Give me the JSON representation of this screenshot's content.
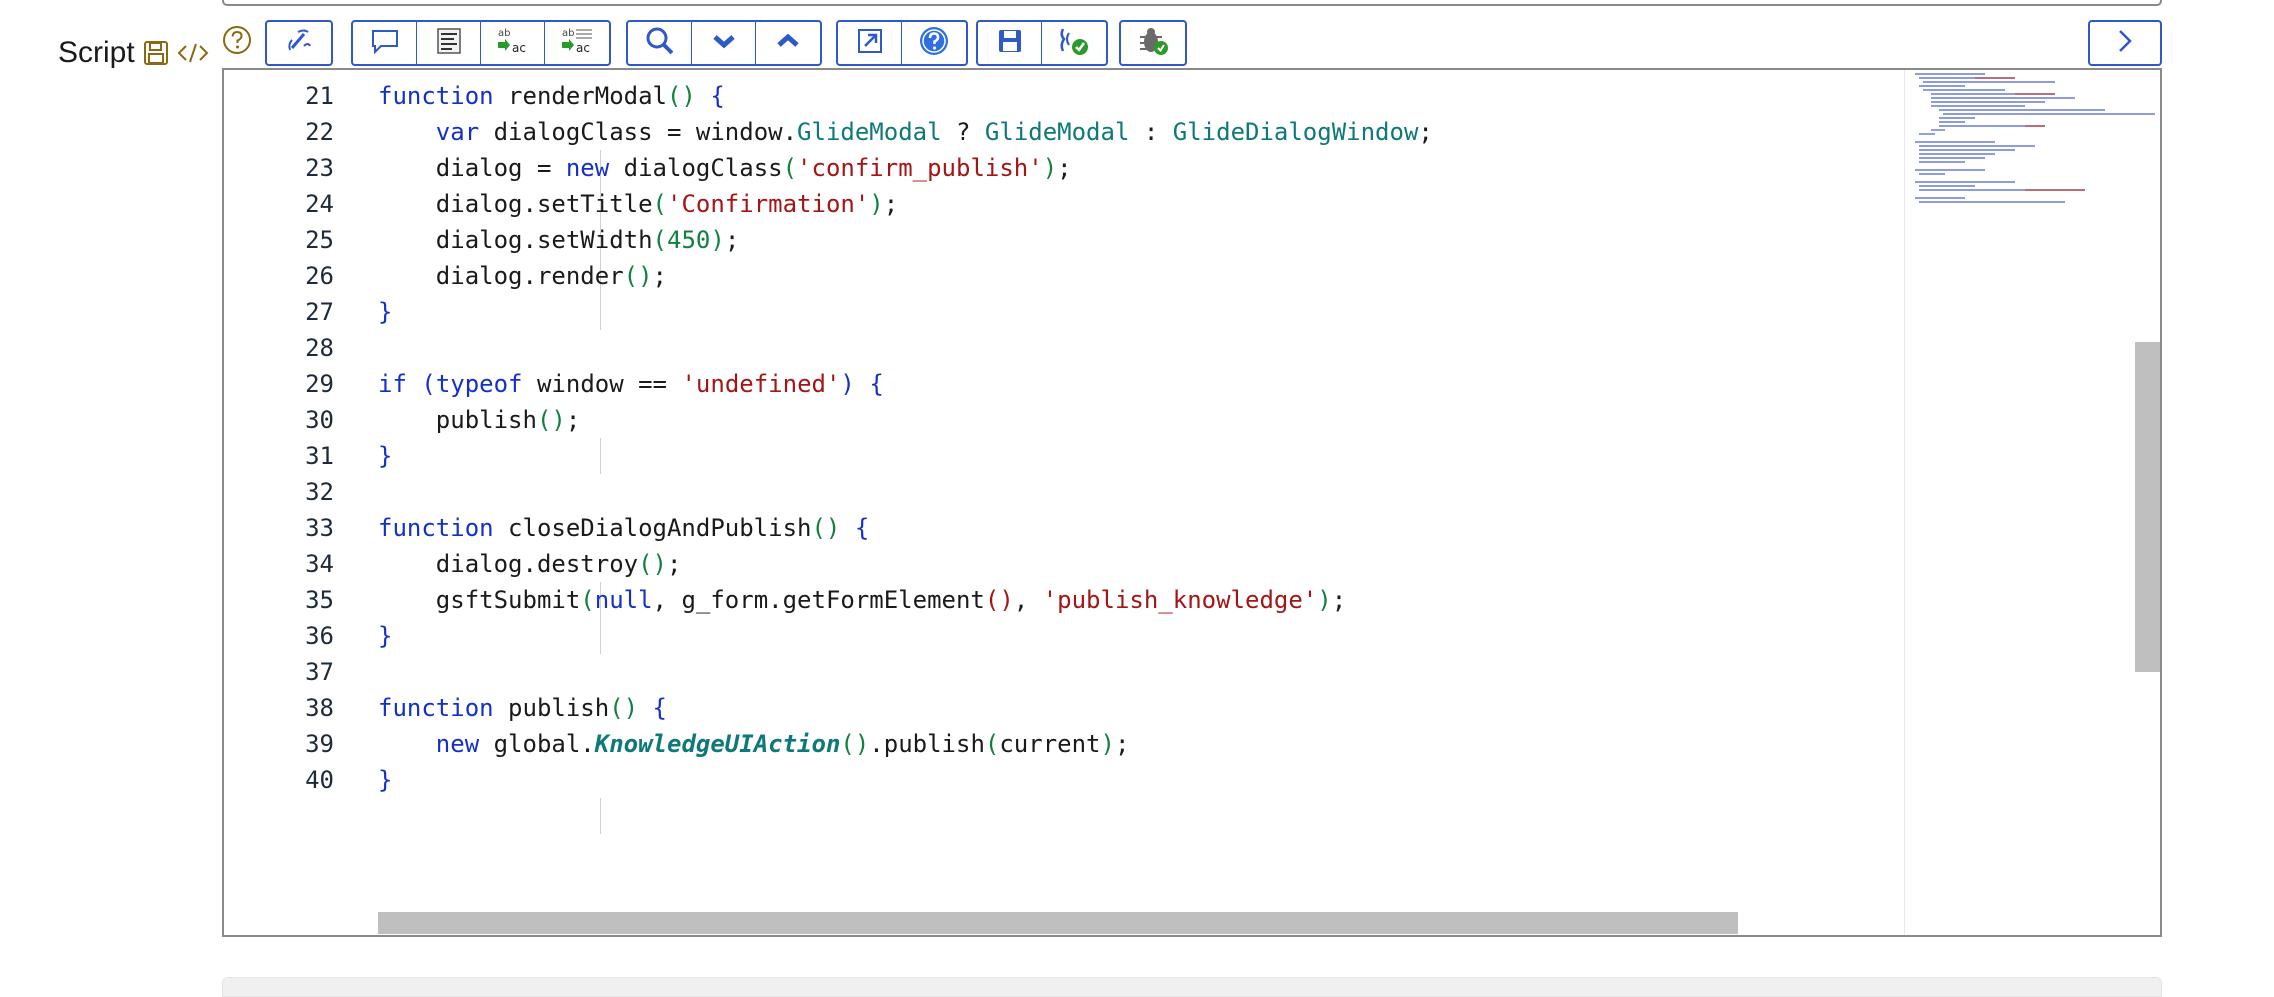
{
  "field": {
    "label": "Script",
    "save_icon": "floppy-icon",
    "code_icon": "code-tag-icon",
    "help_icon": "question-circle-icon"
  },
  "toolbar": {
    "groups": [
      [
        {
          "name": "format-code-button",
          "icon": "wand-icon"
        }
      ],
      [
        {
          "name": "toggle-comment-button",
          "icon": "comment-icon"
        },
        {
          "name": "format-text-button",
          "icon": "text-lines-icon"
        },
        {
          "name": "replace-button",
          "icon": "replace-icon"
        },
        {
          "name": "replace-all-button",
          "icon": "replace-all-icon"
        }
      ],
      [
        {
          "name": "search-button",
          "icon": "magnifier-icon"
        },
        {
          "name": "find-next-button",
          "icon": "chevron-down-icon"
        },
        {
          "name": "find-previous-button",
          "icon": "chevron-up-icon"
        }
      ],
      [
        {
          "name": "fullscreen-button",
          "icon": "expand-arrow-icon"
        },
        {
          "name": "help-button",
          "icon": "help-circle-icon"
        }
      ],
      [
        {
          "name": "save-button",
          "icon": "floppy-icon"
        },
        {
          "name": "syntax-check-button",
          "icon": "check-script-icon"
        }
      ],
      [
        {
          "name": "debug-button",
          "icon": "bug-icon"
        }
      ]
    ],
    "right_button_icon": "chevron-right-icon"
  },
  "colors": {
    "accent": "#2f58c8",
    "keyword": "#1430c8",
    "string": "#a41515",
    "number": "#108040",
    "class": "#0f7878"
  },
  "code_lines": [
    {
      "n": "21",
      "t": [
        [
          "kw",
          "function"
        ],
        [
          "p",
          " renderModal"
        ],
        [
          "paren",
          "()"
        ],
        [
          "p",
          " "
        ],
        [
          "kw",
          "{"
        ]
      ]
    },
    {
      "n": "22",
      "t": [
        [
          "p",
          "    "
        ],
        [
          "kw",
          "var"
        ],
        [
          "p",
          " dialogClass = window."
        ],
        [
          "cls",
          "GlideModal"
        ],
        [
          "p",
          " ? "
        ],
        [
          "cls",
          "GlideModal"
        ],
        [
          "p",
          " : "
        ],
        [
          "cls",
          "GlideDialogWindow"
        ],
        [
          "p",
          ";"
        ]
      ]
    },
    {
      "n": "23",
      "t": [
        [
          "p",
          "    dialog = "
        ],
        [
          "kw",
          "new"
        ],
        [
          "p",
          " dialogClass"
        ],
        [
          "paren",
          "("
        ],
        [
          "str",
          "'confirm_publish'"
        ],
        [
          "paren",
          ")"
        ],
        [
          "p",
          ";"
        ]
      ]
    },
    {
      "n": "24",
      "t": [
        [
          "p",
          "    dialog.setTitle"
        ],
        [
          "paren",
          "("
        ],
        [
          "str",
          "'Confirmation'"
        ],
        [
          "paren",
          ")"
        ],
        [
          "p",
          ";"
        ]
      ]
    },
    {
      "n": "25",
      "t": [
        [
          "p",
          "    dialog.setWidth"
        ],
        [
          "paren",
          "("
        ],
        [
          "num",
          "450"
        ],
        [
          "paren",
          ")"
        ],
        [
          "p",
          ";"
        ]
      ]
    },
    {
      "n": "26",
      "t": [
        [
          "p",
          "    dialog.render"
        ],
        [
          "paren",
          "()"
        ],
        [
          "p",
          ";"
        ]
      ]
    },
    {
      "n": "27",
      "t": [
        [
          "kw",
          "}"
        ]
      ]
    },
    {
      "n": "28",
      "t": []
    },
    {
      "n": "29",
      "t": [
        [
          "kw",
          "if"
        ],
        [
          "p",
          " "
        ],
        [
          "kw",
          "("
        ],
        [
          "kw",
          "typeof"
        ],
        [
          "p",
          " window == "
        ],
        [
          "str",
          "'undefined'"
        ],
        [
          "kw",
          ")"
        ],
        [
          "p",
          " "
        ],
        [
          "kw",
          "{"
        ]
      ]
    },
    {
      "n": "30",
      "t": [
        [
          "p",
          "    publish"
        ],
        [
          "paren",
          "()"
        ],
        [
          "p",
          ";"
        ]
      ]
    },
    {
      "n": "31",
      "t": [
        [
          "kw",
          "}"
        ]
      ]
    },
    {
      "n": "32",
      "t": []
    },
    {
      "n": "33",
      "t": [
        [
          "kw",
          "function"
        ],
        [
          "p",
          " closeDialogAndPublish"
        ],
        [
          "paren",
          "()"
        ],
        [
          "p",
          " "
        ],
        [
          "kw",
          "{"
        ]
      ]
    },
    {
      "n": "34",
      "t": [
        [
          "p",
          "    dialog.destroy"
        ],
        [
          "paren",
          "()"
        ],
        [
          "p",
          ";"
        ]
      ]
    },
    {
      "n": "35",
      "t": [
        [
          "p",
          "    gsftSubmit"
        ],
        [
          "paren",
          "("
        ],
        [
          "kw",
          "null"
        ],
        [
          "p",
          ", g_form.getFormElement"
        ],
        [
          "str",
          "()"
        ],
        [
          "p",
          ", "
        ],
        [
          "str",
          "'publish_knowledge'"
        ],
        [
          "paren",
          ")"
        ],
        [
          "p",
          ";"
        ]
      ]
    },
    {
      "n": "36",
      "t": [
        [
          "kw",
          "}"
        ]
      ]
    },
    {
      "n": "37",
      "t": []
    },
    {
      "n": "38",
      "t": [
        [
          "kw",
          "function"
        ],
        [
          "p",
          " publish"
        ],
        [
          "paren",
          "()"
        ],
        [
          "p",
          " "
        ],
        [
          "kw",
          "{"
        ]
      ]
    },
    {
      "n": "39",
      "t": [
        [
          "p",
          "    "
        ],
        [
          "kw",
          "new"
        ],
        [
          "p",
          " global."
        ],
        [
          "cls-it",
          "KnowledgeUIAction"
        ],
        [
          "paren",
          "()"
        ],
        [
          "p",
          ".publish"
        ],
        [
          "paren",
          "("
        ],
        [
          "p",
          "current"
        ],
        [
          "paren",
          ")"
        ],
        [
          "p",
          ";"
        ]
      ]
    },
    {
      "n": "40",
      "t": [
        [
          "kw",
          "}"
        ]
      ]
    }
  ]
}
